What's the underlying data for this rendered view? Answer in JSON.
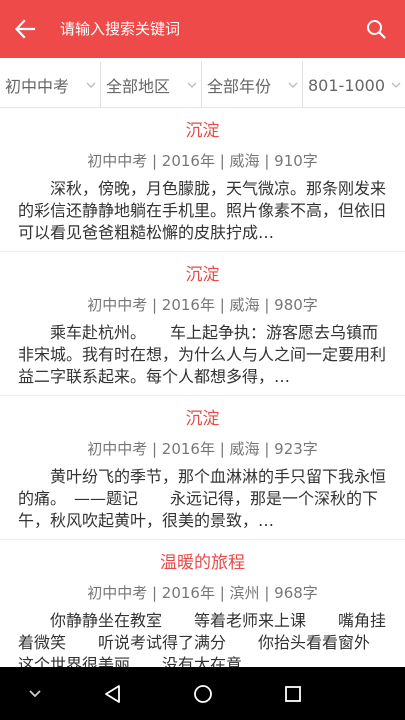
{
  "header": {
    "back_icon": "arrow-left-icon",
    "search_placeholder": "请输入搜索关键词",
    "search_icon": "search-icon",
    "background_color": "#ef4a4a"
  },
  "filters": [
    {
      "label": "初中中考"
    },
    {
      "label": "全部地区"
    },
    {
      "label": "全部年份"
    },
    {
      "label": "801-1000"
    }
  ],
  "articles": [
    {
      "title": "沉淀",
      "meta": "初中中考 | 2016年 | 威海 | 910字",
      "excerpt": "深秋，傍晚，月色朦胧，天气微凉。那条刚发来的彩信还静静地躺在手机里。照片像素不高，但依旧可以看见爸爸粗糙松懈的皮肤拧成…"
    },
    {
      "title": "沉淀",
      "meta": "初中中考 | 2016年 | 威海 | 980字",
      "excerpt": "乘车赴杭州。　　车上起争执：游客愿去乌镇而非宋城。我有时在想，为什么人与人之间一定要用利益二字联系起来。每个人都想多得，…"
    },
    {
      "title": "沉淀",
      "meta": "初中中考 | 2016年 | 威海 | 923字",
      "excerpt": "黄叶纷飞的季节，那个血淋淋的手只留下我永恒的痛。　——题记　　永远记得，那是一个深秋的下午，秋风吹起黄叶，很美的景致，…"
    },
    {
      "title": "温暖的旅程",
      "meta": "初中中考 | 2016年 | 滨州 | 968字",
      "excerpt": "你静静坐在教室　　等着老师来上课　　嘴角挂着微笑　　听说考试得了满分　　你抬头看看窗外　　这个世界很美丽　　没有太在意…"
    }
  ],
  "system_nav": {
    "collapse_icon": "chevron-down-icon",
    "back_icon": "triangle-back-icon",
    "home_icon": "circle-home-icon",
    "recents_icon": "square-recents-icon"
  }
}
